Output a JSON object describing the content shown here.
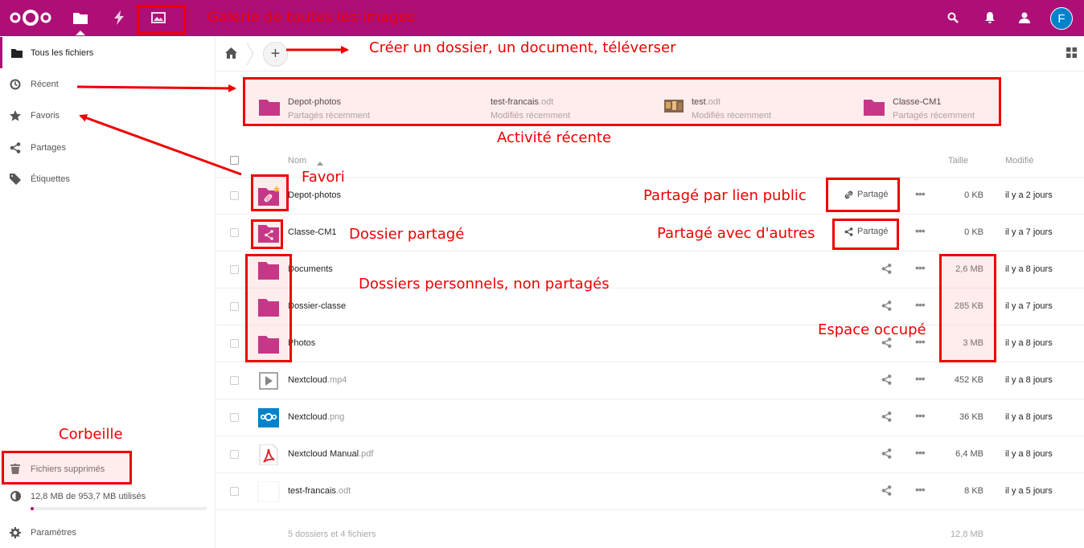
{
  "header": {
    "icons": [
      "nextcloud-logo",
      "files-icon",
      "activity-icon",
      "gallery-icon",
      "search-icon",
      "notifications-icon",
      "contacts-icon"
    ],
    "avatar_letter": "F",
    "brand_color": "#ad0f77"
  },
  "sidebar": {
    "items": [
      {
        "label": "Tous les fichiers",
        "icon": "folder-icon"
      },
      {
        "label": "Récent",
        "icon": "clock-icon"
      },
      {
        "label": "Favoris",
        "icon": "star-icon"
      },
      {
        "label": "Partages",
        "icon": "share-icon"
      },
      {
        "label": "Étiquettes",
        "icon": "tag-icon"
      }
    ],
    "trash_label": "Fichiers supprimés",
    "quota_text": "12,8 MB de 953,7 MB utilisés",
    "quota_fraction": 0.013,
    "settings_label": "Paramètres"
  },
  "recent": [
    {
      "name": "Depot-photos",
      "ext": "",
      "sub": "Partagés récemment",
      "type": "folder"
    },
    {
      "name": "test-francais",
      "ext": ".odt",
      "sub": "Modifiés récemment",
      "type": "doc"
    },
    {
      "name": "test",
      "ext": ".odt",
      "sub": "Modifiés récemment",
      "type": "image"
    },
    {
      "name": "Classe-CM1",
      "ext": "",
      "sub": "Partagés récemment",
      "type": "folder"
    }
  ],
  "table": {
    "col_name": "Nom",
    "col_size": "Taille",
    "col_modified": "Modifié",
    "rows": [
      {
        "name": "Depot-photos",
        "ext": "",
        "size": "0 KB",
        "modified": "il y a 2 jours",
        "share_label": "Partagé",
        "icon": "folder-link-icon"
      },
      {
        "name": "Classe-CM1",
        "ext": "",
        "size": "0 KB",
        "modified": "il y a 7 jours",
        "share_label": "Partagé",
        "icon": "folder-shared-icon"
      },
      {
        "name": "Documents",
        "ext": "",
        "size": "2,6 MB",
        "modified": "il y a 8 jours",
        "share_label": "",
        "icon": "folder-icon"
      },
      {
        "name": "Dossier-classe",
        "ext": "",
        "size": "285 KB",
        "modified": "il y a 7 jours",
        "share_label": "",
        "icon": "folder-icon"
      },
      {
        "name": "Photos",
        "ext": "",
        "size": "3 MB",
        "modified": "il y a 8 jours",
        "share_label": "",
        "icon": "folder-icon"
      },
      {
        "name": "Nextcloud",
        "ext": ".mp4",
        "size": "452 KB",
        "modified": "il y a 8 jours",
        "share_label": "",
        "icon": "video-icon"
      },
      {
        "name": "Nextcloud",
        "ext": ".png",
        "size": "36 KB",
        "modified": "il y a 8 jours",
        "share_label": "",
        "icon": "image-icon"
      },
      {
        "name": "Nextcloud Manual",
        "ext": ".pdf",
        "size": "6,4 MB",
        "modified": "il y a 8 jours",
        "share_label": "",
        "icon": "pdf-icon"
      },
      {
        "name": "test-francais",
        "ext": ".odt",
        "size": "8 KB",
        "modified": "il y a 5 jours",
        "share_label": "",
        "icon": "document-icon"
      }
    ],
    "summary": "5 dossiers et 4 fichiers",
    "summary_size": "12,8 MB"
  },
  "annotations": {
    "gallery": "Galerie de toutes les images",
    "create": "Créer un dossier, un document, téléverser",
    "activity": "Activité récente",
    "favori": "Favori",
    "public_link": "Partagé par lien public",
    "shared_folder": "Dossier partagé",
    "shared_with": "Partagé avec d'autres",
    "personal": "Dossiers personnels, non partagés",
    "space": "Espace occupé",
    "trash": "Corbeille"
  }
}
